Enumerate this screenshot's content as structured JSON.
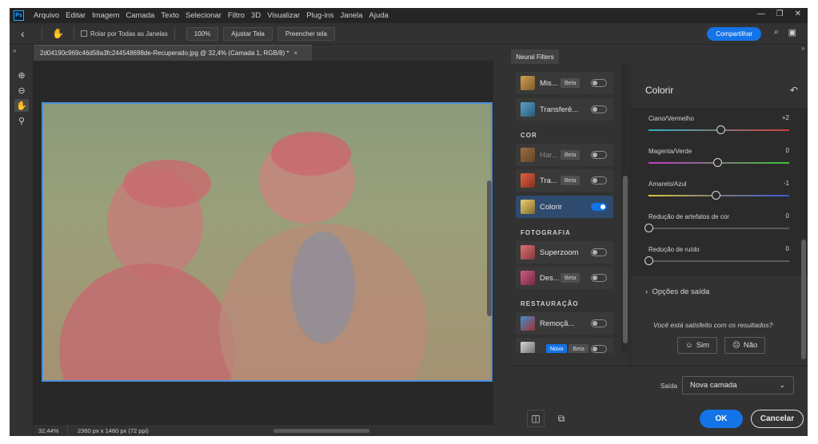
{
  "menubar": {
    "logo": "Ps",
    "items": [
      "Arquivo",
      "Editar",
      "Imagem",
      "Camada",
      "Texto",
      "Selecionar",
      "Filtro",
      "3D",
      "Visualizar",
      "Plug-ins",
      "Janela",
      "Ajuda"
    ]
  },
  "optbar": {
    "scroll_all_label": "Rolar por Todas as Janelas",
    "zoom_value": "100%",
    "fit_screen": "Ajustar Tela",
    "fill_screen": "Preencher tela",
    "share": "Compartilhar"
  },
  "document": {
    "tab_title": "2d04190c969c46d58a3fc244548698de-Recuperado.jpg @ 32,4% (Camada 1, RGB/8) *",
    "close_glyph": "×"
  },
  "status": {
    "zoom": "32,44%",
    "dimensions": "2360 px x 1460 px (72 ppi)"
  },
  "neural_filters": {
    "tab_label": "Neural Filters",
    "items": [
      {
        "name": "Mis...",
        "badge": "Beta",
        "on": false
      },
      {
        "name": "Transferê...",
        "badge": "",
        "on": false
      },
      {
        "section": "COR"
      },
      {
        "name": "Har...",
        "badge": "Beta",
        "on": false,
        "dim": true
      },
      {
        "name": "Tra...",
        "badge": "Beta",
        "on": false
      },
      {
        "name": "Colorir",
        "badge": "",
        "on": true,
        "active": true
      },
      {
        "section": "FOTOGRAFIA"
      },
      {
        "name": "Superzoom",
        "badge": "",
        "on": false
      },
      {
        "name": "Des...",
        "badge": "Beta",
        "on": false
      },
      {
        "section": "RESTAURAÇÃO"
      },
      {
        "name": "Remoçã...",
        "badge": "",
        "on": false
      },
      {
        "name": "",
        "badge": "Novo",
        "badge2": "Beta",
        "on": false
      }
    ]
  },
  "colorize": {
    "title": "Colorir",
    "sliders": [
      {
        "label": "Ciano/Vermelho",
        "value": "+2",
        "position": 0.51
      },
      {
        "label": "Magenta/Verde",
        "value": "0",
        "position": 0.49
      },
      {
        "label": "Amarelo/Azul",
        "value": "-1",
        "position": 0.48
      },
      {
        "label": "Redução de artefatos de cor",
        "value": "0",
        "position": 0.0
      },
      {
        "label": "Redução de ruído",
        "value": "0",
        "position": 0.0
      }
    ],
    "output_options": "Opções de saída",
    "question": "Você está satisfeito com os resultados?",
    "yes": "Sim",
    "no": "Não"
  },
  "output": {
    "label": "Saída",
    "value": "Nova camada"
  },
  "buttons": {
    "ok": "OK",
    "cancel": "Cancelar"
  },
  "colors": {
    "accent": "#1473e6",
    "panel_bg": "#323232",
    "canvas_bg": "#282828"
  }
}
